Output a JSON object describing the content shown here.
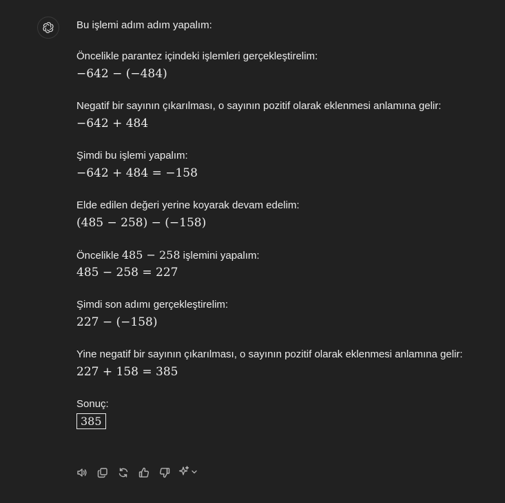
{
  "assistant": {
    "avatar_icon": "openai-logo-icon"
  },
  "message": {
    "intro": "Bu işlemi adım adım yapalım:",
    "steps": [
      {
        "text": "Öncelikle parantez içindeki işlemleri gerçekleştirelim:",
        "math": "−642 − (−484)"
      },
      {
        "text": "Negatif bir sayının çıkarılması, o sayının pozitif olarak eklenmesi anlamına gelir:",
        "math": "−642 + 484"
      },
      {
        "text": "Şimdi bu işlemi yapalım:",
        "math": "−642 + 484 = −158"
      },
      {
        "text": "Elde edilen değeri yerine koyarak devam edelim:",
        "math": "(485 − 258) − (−158)"
      },
      {
        "text_before": "Öncelikle ",
        "text_math": "485 − 258",
        "text_after": " işlemini yapalım:",
        "math": "485 − 258 = 227"
      },
      {
        "text": "Şimdi son adımı gerçekleştirelim:",
        "math": "227 − (−158)"
      },
      {
        "text": "Yine negatif bir sayının çıkarılması, o sayının pozitif olarak eklenmesi anlamına gelir:",
        "math": "227 + 158 = 385"
      }
    ],
    "result_label": "Sonuç:",
    "result_value": "385"
  },
  "actions": {
    "read_aloud_icon": "speaker-icon",
    "copy_icon": "copy-icon",
    "regenerate_icon": "regenerate-icon",
    "good_response_icon": "thumbs-up-icon",
    "bad_response_icon": "thumbs-down-icon",
    "model_switch_icon": "sparkle-icon"
  }
}
